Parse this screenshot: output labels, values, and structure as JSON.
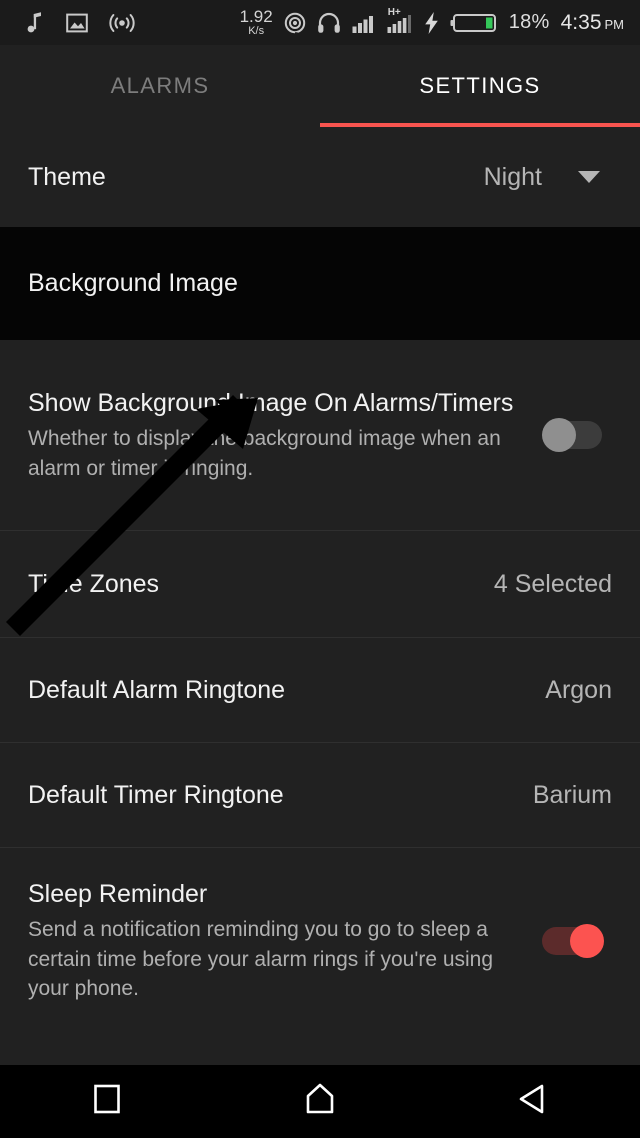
{
  "statusbar": {
    "left_icons": [
      {
        "name": "music-note-icon",
        "glyph": "music"
      },
      {
        "name": "image-icon",
        "glyph": "image"
      },
      {
        "name": "cast-broadcast-icon",
        "glyph": "broadcast"
      }
    ],
    "network_speed_value": "1.92",
    "network_speed_unit": "K/s",
    "right_icons": [
      {
        "name": "location-icon",
        "glyph": "location"
      },
      {
        "name": "headphones-icon",
        "glyph": "headphones"
      },
      {
        "name": "signal-bars-icon",
        "glyph": "signal"
      },
      {
        "name": "hplus-data-icon",
        "glyph": "hplus",
        "label": "H+"
      },
      {
        "name": "charging-bolt-icon",
        "glyph": "bolt"
      },
      {
        "name": "battery-icon",
        "glyph": "battery"
      }
    ],
    "battery_percent": "18%",
    "clock_time": "4:35",
    "clock_ampm": "PM"
  },
  "tabs": [
    {
      "label": "ALARMS",
      "active": false
    },
    {
      "label": "SETTINGS",
      "active": true
    }
  ],
  "settings": {
    "theme": {
      "title": "Theme",
      "value": "Night",
      "caret_icon": "chevron-down-icon"
    },
    "background_image": {
      "title": "Background Image"
    },
    "show_background_image": {
      "title": "Show Background Image On Alarms/Timers",
      "summary": "Whether to display the background image when an alarm or timer is ringing.",
      "toggle_state": "off"
    },
    "time_zones": {
      "title": "Time Zones",
      "value": "4 Selected"
    },
    "default_alarm_ringtone": {
      "title": "Default Alarm Ringtone",
      "value": "Argon"
    },
    "default_timer_ringtone": {
      "title": "Default Timer Ringtone",
      "value": "Barium"
    },
    "sleep_reminder": {
      "title": "Sleep Reminder",
      "summary": "Send a notification reminding you to go to sleep a certain time before your alarm rings if you're using your phone.",
      "toggle_state": "on"
    }
  },
  "navbar": [
    {
      "name": "recents-button",
      "glyph": "square"
    },
    {
      "name": "home-button",
      "glyph": "home"
    },
    {
      "name": "back-button",
      "glyph": "triangle-left"
    }
  ],
  "colors": {
    "accent": "#f8544f",
    "toggle_on_thumb": "#fc5350",
    "toggle_on_track": "#5c2b2b",
    "toggle_off_thumb": "#8f8f8f",
    "background": "#212121",
    "row_highlight": "#050505",
    "annotation_arrow": "#000000"
  }
}
